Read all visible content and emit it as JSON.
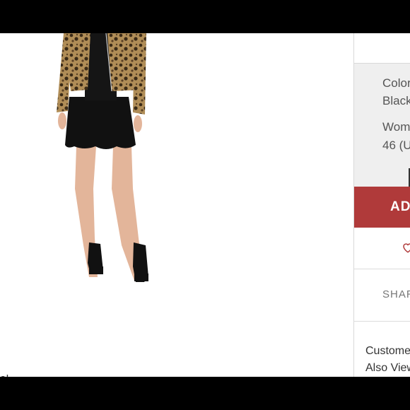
{
  "product": {
    "color_label": "Color",
    "color_value": "Black",
    "size_label": "Wom",
    "size_value": "46 (U",
    "add_button_label": "ADD",
    "share_label": "SHAR",
    "also_viewed_line1": "Custome",
    "also_viewed_line2": "Also View"
  },
  "left": {
    "partial_heading": "e!"
  },
  "icons": {
    "favorite": "heart-icon"
  },
  "colors": {
    "accent": "#b03a3a",
    "panel": "#efefef",
    "border": "#d9d9d9"
  }
}
